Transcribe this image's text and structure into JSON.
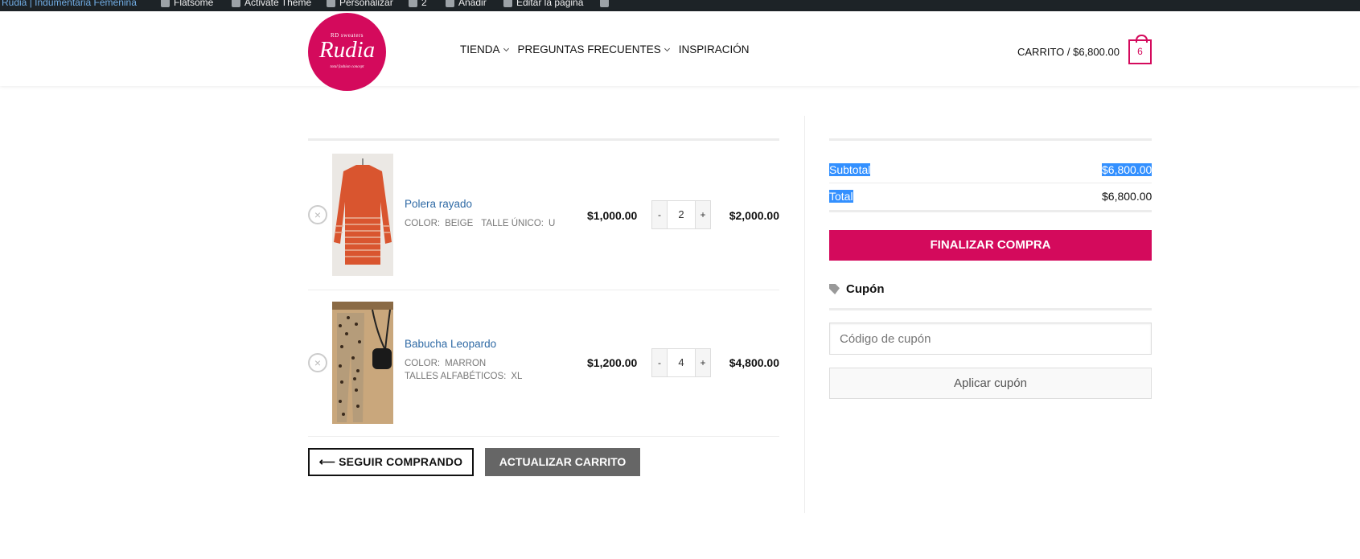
{
  "adminbar": {
    "site_name": "Rudia | Indumentaria Femenina",
    "items": [
      "Flatsome",
      "Activate Theme",
      "Personalizar",
      "2",
      "Añadir",
      "Editar la página"
    ]
  },
  "header": {
    "logo": {
      "top": "RD sweaters",
      "main": "Rudia",
      "sub": "total fashion concept"
    },
    "nav": [
      {
        "label": "TIENDA",
        "has_dropdown": true
      },
      {
        "label": "PREGUNTAS FRECUENTES",
        "has_dropdown": true
      },
      {
        "label": "INSPIRACIÓN",
        "has_dropdown": false
      }
    ],
    "cart_label": "CARRITO / $6,800.00",
    "cart_count": "6"
  },
  "cart": {
    "items": [
      {
        "name": "Polera rayado",
        "attributes": [
          {
            "key": "COLOR:",
            "value": "BEIGE"
          },
          {
            "key": "TALLE ÚNICO:",
            "value": "U"
          }
        ],
        "price": "$1,000.00",
        "qty": "2",
        "subtotal": "$2,000.00"
      },
      {
        "name": "Babucha Leopardo",
        "attributes": [
          {
            "key": "COLOR:",
            "value": "MARRON"
          },
          {
            "key": "TALLES ALFABÉTICOS:",
            "value": "XL"
          }
        ],
        "price": "$1,200.00",
        "qty": "4",
        "subtotal": "$4,800.00"
      }
    ],
    "continue_label": "⟵ SEGUIR COMPRANDO",
    "update_label": "ACTUALIZAR CARRITO",
    "qty_minus": "-",
    "qty_plus": "+",
    "remove_symbol": "×"
  },
  "totals": {
    "subtotal_label": "Subtotal",
    "subtotal_value": "$6,800.00",
    "total_label": "Total",
    "total_value": "$6,800.00",
    "checkout_label": "FINALIZAR COMPRA",
    "coupon_title": "Cupón",
    "coupon_placeholder": "Código de cupón",
    "apply_coupon_label": "Aplicar cupón"
  },
  "colors": {
    "brand": "#d40a5c",
    "link": "#2f6aa5",
    "selection": "#3390ff",
    "secondary_button": "#666666"
  }
}
